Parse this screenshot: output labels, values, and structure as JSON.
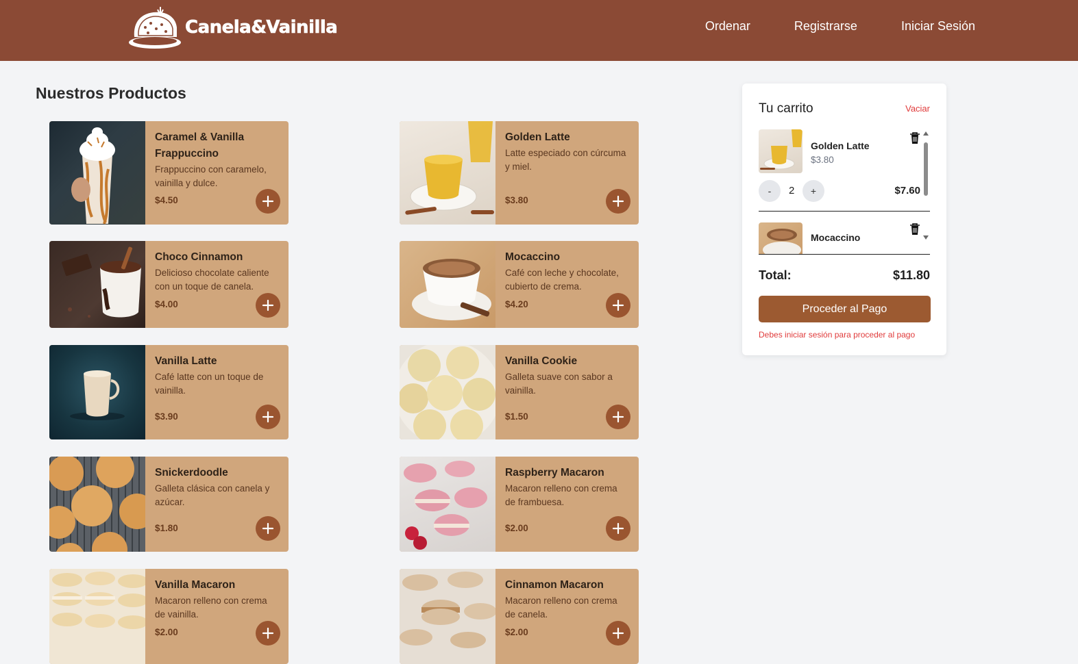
{
  "brand": {
    "name": "Canela&Vainilla",
    "colors": {
      "header": "#8b4a35",
      "card": "#d0a67c",
      "accent": "#9c5a31",
      "danger": "#e03a3a"
    }
  },
  "nav": {
    "items": [
      "Ordenar",
      "Registrarse",
      "Iniciar Sesión"
    ]
  },
  "products": {
    "title": "Nuestros Productos",
    "items": [
      {
        "name": "Caramel & Vanilla Frappuccino",
        "desc": "Frappuccino con caramelo, vainilla y dulce.",
        "price": "$4.50",
        "image": "frappuccino-photo"
      },
      {
        "name": "Golden Latte",
        "desc": "Latte especiado con cúrcuma y miel.",
        "price": "$3.80",
        "image": "golden-latte-photo"
      },
      {
        "name": "Choco Cinnamon",
        "desc": "Delicioso chocolate caliente con un toque de canela.",
        "price": "$4.00",
        "image": "hot-chocolate-photo"
      },
      {
        "name": "Mocaccino",
        "desc": "Café con leche y chocolate, cubierto de crema.",
        "price": "$4.20",
        "image": "mocaccino-photo"
      },
      {
        "name": "Vanilla Latte",
        "desc": "Café latte con un toque de vainilla.",
        "price": "$3.90",
        "image": "vanilla-latte-photo"
      },
      {
        "name": "Vanilla Cookie",
        "desc": "Galleta suave con sabor a vainilla.",
        "price": "$1.50",
        "image": "vanilla-cookie-photo"
      },
      {
        "name": "Snickerdoodle",
        "desc": "Galleta clásica con canela y azúcar.",
        "price": "$1.80",
        "image": "snickerdoodle-photo"
      },
      {
        "name": "Raspberry Macaron",
        "desc": "Macaron relleno con crema de frambuesa.",
        "price": "$2.00",
        "image": "raspberry-macaron-photo"
      },
      {
        "name": "Vanilla Macaron",
        "desc": "Macaron relleno con crema de vainilla.",
        "price": "$2.00",
        "image": "vanilla-macaron-photo"
      },
      {
        "name": "Cinnamon Macaron",
        "desc": "Macaron relleno con crema de canela.",
        "price": "$2.00",
        "image": "cinnamon-macaron-photo"
      }
    ]
  },
  "cart": {
    "title": "Tu carrito",
    "clear_label": "Vaciar",
    "items": [
      {
        "name": "Golden Latte",
        "price": "$3.80",
        "qty": "2",
        "subtotal": "$7.60",
        "minus": "-",
        "plus": "+"
      },
      {
        "name": "Mocaccino"
      }
    ],
    "total_label": "Total:",
    "total_value": "$11.80",
    "checkout_label": "Proceder al Pago",
    "login_note": "Debes iniciar sesión para proceder al pago"
  }
}
